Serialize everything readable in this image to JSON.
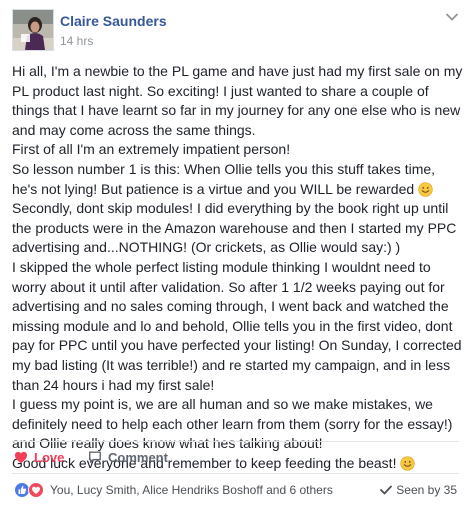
{
  "header": {
    "author": "Claire Saunders",
    "time": "14 hrs"
  },
  "body": {
    "paragraphs": [
      "Hi all, I'm a newbie to the PL game and have just had my first sale on my PL product last night. So exciting! I just wanted to share a couple of things that I have learnt so far in my journey for any one else who is new and may come across the same things.",
      "First of all I'm an extremely impatient person!",
      "So lesson number 1 is this: When Ollie tells you this stuff takes time, he's not lying! But patience is a virtue and you WILL be rewarded",
      "Secondly, dont skip modules! I did everything by the book right up until the products were in the Amazon warehouse and then I started my PPC advertising and...NOTHING! (Or crickets, as Ollie would say:) )",
      "I skipped the whole perfect listing module thinking I wouldnt need to worry about it until after validation. So after 1 1/2 weeks paying out for advertising and no sales coming through, I went back and watched the missing module and lo and behold, Ollie tells you in the first video, dont pay for PPC until you have perfected your listing! On Sunday, I corrected my bad listing (It was terrible!) and re started my campaign, and in less than 24 hours i had my first sale!",
      "I guess my point is, we are all human and so we make mistakes, we definitely need to help each other learn from them (sorry for the essay!) and Ollie really does know what hes talking about!",
      "Good luck everyone and remember to keep feeding the beast!"
    ]
  },
  "actions": {
    "love_label": "Love",
    "comment_label": "Comment"
  },
  "footer": {
    "reactions_text": "You, Lucy Smith, Alice Hendriks Boshoff and 6 others",
    "seen_text": "Seen by 35"
  },
  "colors": {
    "author_link": "#365899",
    "love": "#f33e58",
    "like": "#4c7be8",
    "muted": "#90949c"
  },
  "icons": [
    "avatar-photo",
    "chevron-down-icon",
    "smile-emoji-icon",
    "heart-icon",
    "comment-icon",
    "like-reaction-icon",
    "love-reaction-icon",
    "check-icon"
  ]
}
